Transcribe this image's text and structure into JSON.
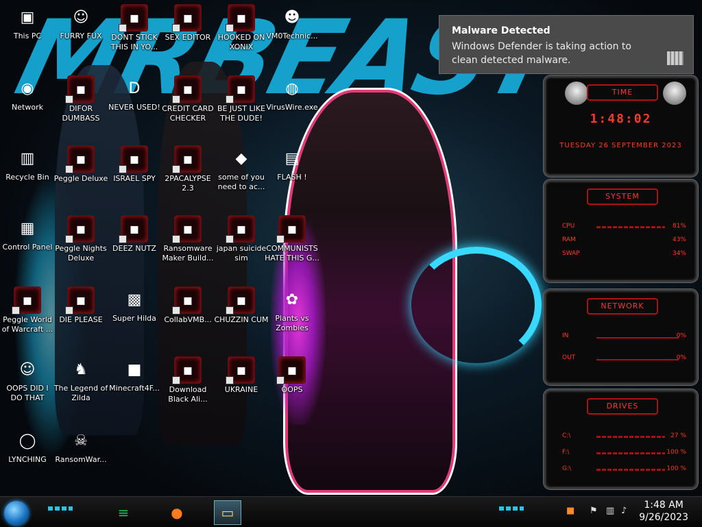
{
  "wallpaper": {
    "title": "MRBEAST"
  },
  "desktop_icons": [
    {
      "label": "This PC",
      "icon": "computer-icon"
    },
    {
      "label": "FURRY FUX",
      "icon": "cartoon-icon"
    },
    {
      "label": "DONT STICK THIS IN YO...",
      "icon": "exe-icon"
    },
    {
      "label": "SEX EDITOR",
      "icon": "exe-icon"
    },
    {
      "label": "HOOKED ON XONIX",
      "icon": "exe-icon"
    },
    {
      "label": "VM0Technic...",
      "icon": "doctor-icon"
    },
    {
      "label": "Network",
      "icon": "network-icon"
    },
    {
      "label": "DIFOR DUMBASS",
      "icon": "exe-icon"
    },
    {
      "label": "NEVER USED!",
      "icon": "dev-icon"
    },
    {
      "label": "CREDIT CARD CHECKER",
      "icon": "exe-icon"
    },
    {
      "label": "BE JUST LIKE THE DUDE!",
      "icon": "exe-icon"
    },
    {
      "label": "VirusWire.exe",
      "icon": "lime-icon"
    },
    {
      "label": "Recycle Bin",
      "icon": "recycle-bin-icon"
    },
    {
      "label": "Peggle Deluxe",
      "icon": "exe-icon"
    },
    {
      "label": "ISRAEL SPY",
      "icon": "exe-icon"
    },
    {
      "label": "2PACALYPSE 2.3",
      "icon": "exe-icon"
    },
    {
      "label": "some of you need to ac...",
      "icon": "beaver-icon"
    },
    {
      "label": "FLASH !",
      "icon": "file-icon"
    },
    {
      "label": "Control Panel",
      "icon": "control-panel-icon"
    },
    {
      "label": "Peggle Nights Deluxe",
      "icon": "exe-icon"
    },
    {
      "label": "DEEZ NUTZ",
      "icon": "exe-icon"
    },
    {
      "label": "Ransomware Maker Build...",
      "icon": "exe-icon"
    },
    {
      "label": "japan suicide sim",
      "icon": "exe-icon"
    },
    {
      "label": "COMMUNISTS HATE THIS G...",
      "icon": "exe-icon"
    },
    {
      "label": "Peggle World of Warcraft ...",
      "icon": "exe-icon"
    },
    {
      "label": "DIE PLEASE",
      "icon": "exe-icon"
    },
    {
      "label": "Super Hilda",
      "icon": "pixel-icon"
    },
    {
      "label": "CollabVMB...",
      "icon": "exe-icon"
    },
    {
      "label": "CHUZZIN CUM",
      "icon": "exe-icon"
    },
    {
      "label": "Plants vs Zombies",
      "icon": "plant-icon"
    },
    {
      "label": "OOPS DID I DO THAT",
      "icon": "portrait-icon"
    },
    {
      "label": "The Legend of Zilda",
      "icon": "link-sprite-icon"
    },
    {
      "label": "Minecraft4F...",
      "icon": "minecraft-block-icon"
    },
    {
      "label": "Download Black Ali...",
      "icon": "exe-icon"
    },
    {
      "label": "UKRAINE",
      "icon": "exe-icon"
    },
    {
      "label": "OOPS",
      "icon": "exe-icon"
    },
    {
      "label": "LYNCHING",
      "icon": "noose-icon"
    },
    {
      "label": "RansomWar...",
      "icon": "skull-icon"
    }
  ],
  "notification": {
    "title": "Malware Detected",
    "body": "Windows Defender is taking action to clean detected malware."
  },
  "gadgets": {
    "time": {
      "header": "TIME",
      "clock": "1:48:02",
      "date": "TUESDAY 26 SEPTEMBER 2023"
    },
    "system": {
      "header": "SYSTEM",
      "rows": [
        {
          "k": "CPU",
          "v": "81%"
        },
        {
          "k": "RAM",
          "v": "43%"
        },
        {
          "k": "SWAP",
          "v": "34%"
        }
      ]
    },
    "network": {
      "header": "NETWORK",
      "rows": [
        {
          "k": "IN",
          "v": "0%"
        },
        {
          "k": "OUT",
          "v": "0%"
        }
      ]
    },
    "drives": {
      "header": "DRIVES",
      "rows": [
        {
          "k": "C:\\",
          "v": "27 %"
        },
        {
          "k": "F:\\",
          "v": "100 %"
        },
        {
          "k": "G:\\",
          "v": "100 %"
        }
      ]
    }
  },
  "taskbar": {
    "pinned": [
      {
        "name": "spotify-icon",
        "glyph": "≡"
      },
      {
        "name": "firefox-icon",
        "glyph": "●"
      },
      {
        "name": "file-explorer-icon",
        "glyph": "▭"
      }
    ],
    "time": "1:48 AM",
    "date": "9/26/2023"
  },
  "colors": {
    "accent": "#ff3a2a",
    "teal": "#1fc8e6",
    "toast_bg": "#4a4a4a"
  }
}
